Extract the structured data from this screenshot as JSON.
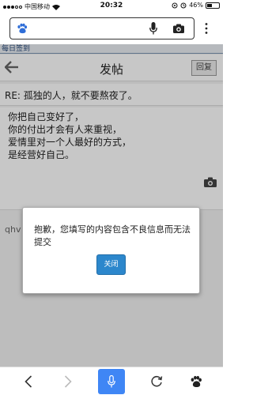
{
  "status_bar": {
    "carrier": "中国移动",
    "time": "20:32",
    "battery": "46%",
    "battery_level": 0.46
  },
  "icons": {
    "paw": "baidu-paw-icon",
    "mic": "microphone-icon",
    "camera": "camera-icon",
    "menu": "more-vertical-icon",
    "back": "back-arrow-icon"
  },
  "sign_strip": {
    "label": "每日签到"
  },
  "header": {
    "title": "发帖",
    "reply_label": "回复"
  },
  "post": {
    "subject": "RE: 孤独的人，就不要熬夜了。",
    "lines": [
      "你把自己变好了，",
      "你的付出才会有人来重视，",
      "爱情里对一个人最好的方式，",
      "是经营好自己。"
    ],
    "captcha_text": "qhv"
  },
  "dialog": {
    "message": "抱歉，您填写的内容包含不良信息而无法提交",
    "close_label": "关闭",
    "button_color": "#2c87cc"
  },
  "toolbar": {
    "voice_color": "#3f86f5"
  }
}
